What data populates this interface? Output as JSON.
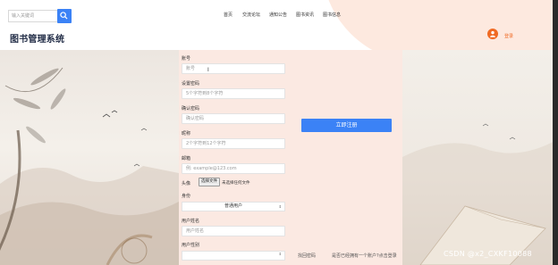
{
  "header": {
    "search": {
      "placeholder": "输入关键词"
    },
    "nav": [
      {
        "label": "首页"
      },
      {
        "label": "交流论坛"
      },
      {
        "label": "通知公告"
      },
      {
        "label": "图书资讯"
      },
      {
        "label": "图书信息"
      }
    ],
    "brand": "图书管理系统",
    "login_label": "登录"
  },
  "form": {
    "account": {
      "label": "账号",
      "placeholder": "账号"
    },
    "password": {
      "label": "设置密码",
      "placeholder": "5个字符到8个字符"
    },
    "confirm": {
      "label": "确认密码",
      "placeholder": "确认密码"
    },
    "nickname": {
      "label": "昵称",
      "placeholder": "2个字符到12个字符"
    },
    "email": {
      "label": "邮箱",
      "placeholder": "例: example@123.com"
    },
    "avatar": {
      "label": "头像",
      "button": "选择文件",
      "status": "未选择任何文件"
    },
    "role": {
      "label": "身份",
      "value": "普通用户"
    },
    "username": {
      "label": "用户姓名",
      "placeholder": "用户姓名"
    },
    "gender": {
      "label": "用户性别"
    }
  },
  "actions": {
    "register": "立即注册",
    "find_password": "找回密码",
    "has_account": "是否已经拥有一个账户?点击登录"
  },
  "watermark": "CSDN @x2_CXKF10088",
  "colors": {
    "primary": "#3b82f6",
    "accent": "#f06a23",
    "panel": "#fbe9e2"
  }
}
